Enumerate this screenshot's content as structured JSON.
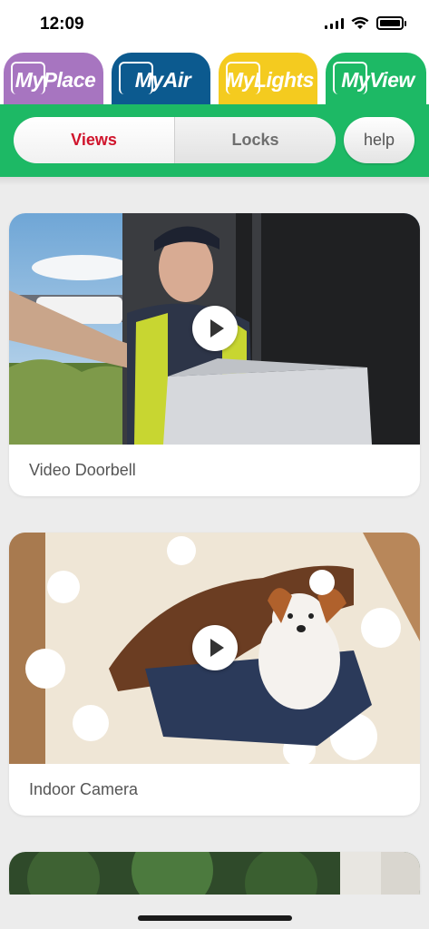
{
  "status_bar": {
    "time": "12:09"
  },
  "app_tabs": [
    {
      "prefix": "My",
      "name": "Place",
      "color": "#a775c0"
    },
    {
      "prefix": "My",
      "name": "Air",
      "color": "#0c5a8f"
    },
    {
      "prefix": "My",
      "name": "Lights",
      "color": "#f4cb1f"
    },
    {
      "prefix": "My",
      "name": "View",
      "color": "#1db965"
    }
  ],
  "segments": {
    "views": "Views",
    "locks": "Locks",
    "selected": "views"
  },
  "help_label": "help",
  "cards": [
    {
      "label": "Video Doorbell",
      "thumbnail": "video-doorbell-thumbnail",
      "play_icon": "play-icon"
    },
    {
      "label": "Indoor Camera",
      "thumbnail": "indoor-camera-thumbnail",
      "play_icon": "play-icon"
    },
    {
      "label": "",
      "thumbnail": "outdoor-camera-thumbnail"
    }
  ],
  "colors": {
    "accent_green": "#1db965",
    "selected_red": "#d0142c"
  }
}
